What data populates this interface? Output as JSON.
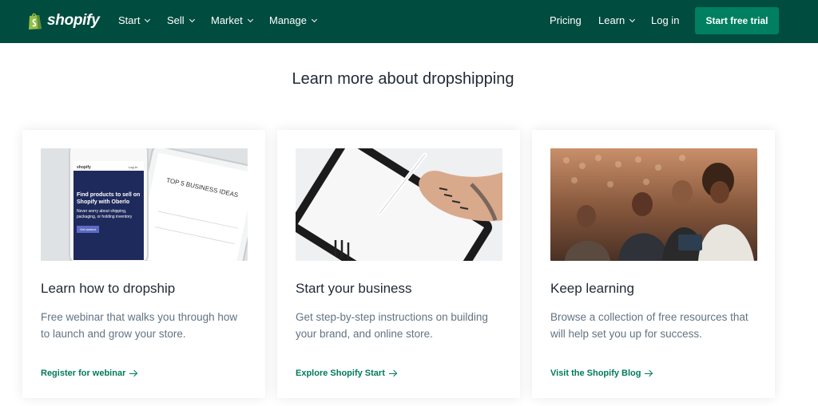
{
  "nav": {
    "logo_text": "shopify",
    "items": [
      {
        "label": "Start"
      },
      {
        "label": "Sell"
      },
      {
        "label": "Market"
      },
      {
        "label": "Manage"
      }
    ],
    "pricing": "Pricing",
    "learn": "Learn",
    "login": "Log in",
    "cta": "Start free trial"
  },
  "heading": "Learn more about dropshipping",
  "cards": [
    {
      "title": "Learn how to dropship",
      "description": "Free webinar that walks you through how to launch and grow your store.",
      "link": "Register for webinar",
      "image": {
        "phone_brand": "shopify",
        "phone_login": "Log in",
        "phone_headline": "Find products to sell on Shopify with Oberlo",
        "phone_sub": "Never worry about shipping, packaging, or holding inventory",
        "phone_button": "Get started",
        "tablet_text": "TOP 5 BUSINESS IDEAS"
      }
    },
    {
      "title": "Start your business",
      "description": "Get step-by-step instructions on building your brand, and online store.",
      "link": "Explore Shopify Start"
    },
    {
      "title": "Keep learning",
      "description": "Browse a collection of free resources that will help set you up for success.",
      "link": "Visit the Shopify Blog"
    }
  ],
  "colors": {
    "nav_bg": "#004c3f",
    "cta_bg": "#008060",
    "link": "#007a5c"
  }
}
